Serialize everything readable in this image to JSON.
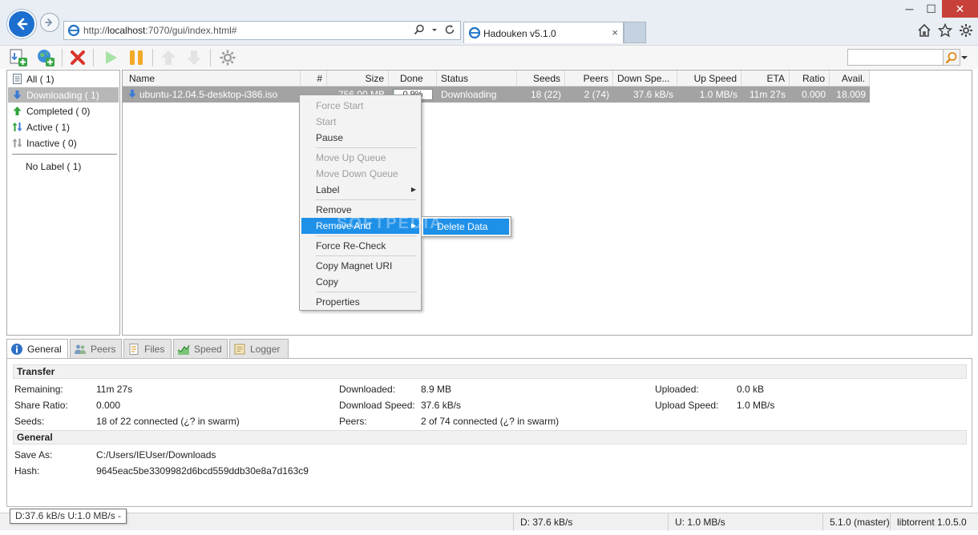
{
  "browser": {
    "url_prefix": "http://",
    "url_host": "localhost",
    "url_rest": ":7070/gui/index.html#",
    "tab_title": "Hadouken v5.1.0",
    "tab_close": "×",
    "min_label": "─",
    "max_label": "☐",
    "close_label": "✕"
  },
  "labels": [
    {
      "name": "All ( 1)",
      "icon": "all-icon"
    },
    {
      "name": "Downloading ( 1)",
      "icon": "download-arrow-icon"
    },
    {
      "name": "Completed ( 0)",
      "icon": "upload-arrow-icon"
    },
    {
      "name": "Active ( 1)",
      "icon": "active-arrows-icon"
    },
    {
      "name": "Inactive ( 0)",
      "icon": "inactive-arrows-icon"
    },
    {
      "name": "No Label ( 1)",
      "icon": ""
    }
  ],
  "table": {
    "columns": [
      "Name",
      "#",
      "Size",
      "Done",
      "Status",
      "Seeds",
      "Peers",
      "Down Spe...",
      "Up Speed",
      "ETA",
      "Ratio",
      "Avail."
    ],
    "row": {
      "name": "ubuntu-12.04.5-desktop-i386.iso",
      "queue": "",
      "size": "756.00 MB",
      "done": "0.9%",
      "done_fraction": 0.009,
      "status": "Downloading",
      "seeds": "18 (22)",
      "peers": "2 (74)",
      "down_speed": "37.6 kB/s",
      "up_speed": "1.0 MB/s",
      "eta": "11m 27s",
      "ratio": "0.000",
      "avail": "18.009"
    }
  },
  "context_menu": {
    "items": [
      {
        "label": "Force Start",
        "disabled": true
      },
      {
        "label": "Start",
        "disabled": true
      },
      {
        "label": "Pause",
        "disabled": false
      },
      {
        "label": "Move Up Queue",
        "disabled": true
      },
      {
        "label": "Move Down Queue",
        "disabled": true
      },
      {
        "label": "Label",
        "disabled": false,
        "submenu": true
      },
      {
        "label": "Remove",
        "disabled": false
      },
      {
        "label": "Remove And",
        "disabled": false,
        "submenu": true,
        "highlighted": true
      },
      {
        "label": "Force Re-Check",
        "disabled": false
      },
      {
        "label": "Copy Magnet URI",
        "disabled": false
      },
      {
        "label": "Copy",
        "disabled": false
      },
      {
        "label": "Properties",
        "disabled": false
      }
    ],
    "submenu_item": "Delete Data"
  },
  "watermark": "SOFTPEDIA",
  "bottom_tabs": [
    "General",
    "Peers",
    "Files",
    "Speed",
    "Logger"
  ],
  "details": {
    "transfer_title": "Transfer",
    "remaining_label": "Remaining:",
    "remaining": "11m 27s",
    "share_ratio_label": "Share Ratio:",
    "share_ratio": "0.000",
    "seeds_label": "Seeds:",
    "seeds": "18 of 22 connected (¿? in swarm)",
    "downloaded_label": "Downloaded:",
    "downloaded": "8.9 MB",
    "download_speed_label": "Download Speed:",
    "download_speed": "37.6 kB/s",
    "peers_label": "Peers:",
    "peers": "2 of 74 connected (¿? in swarm)",
    "uploaded_label": "Uploaded:",
    "uploaded": "0.0 kB",
    "upload_speed_label": "Upload Speed:",
    "upload_speed": "1.0 MB/s",
    "general_title": "General",
    "save_as_label": "Save As:",
    "save_as": "C:/Users/IEUser/Downloads",
    "hash_label": "Hash:",
    "hash": "9645eac5be3309982d6bcd559ddb30e8a7d163c9"
  },
  "statusbar": {
    "tooltip": "D:37.6 kB/s U:1.0 MB/s -",
    "down": "D: 37.6 kB/s",
    "up": "U: 1.0 MB/s",
    "version": "5.1.0 (master)",
    "lib": "libtorrent 1.0.5.0"
  },
  "colors": {
    "accent": "#1e90e8",
    "selected_row": "#a3a3a3",
    "browser_back": "#1c6fcf"
  }
}
